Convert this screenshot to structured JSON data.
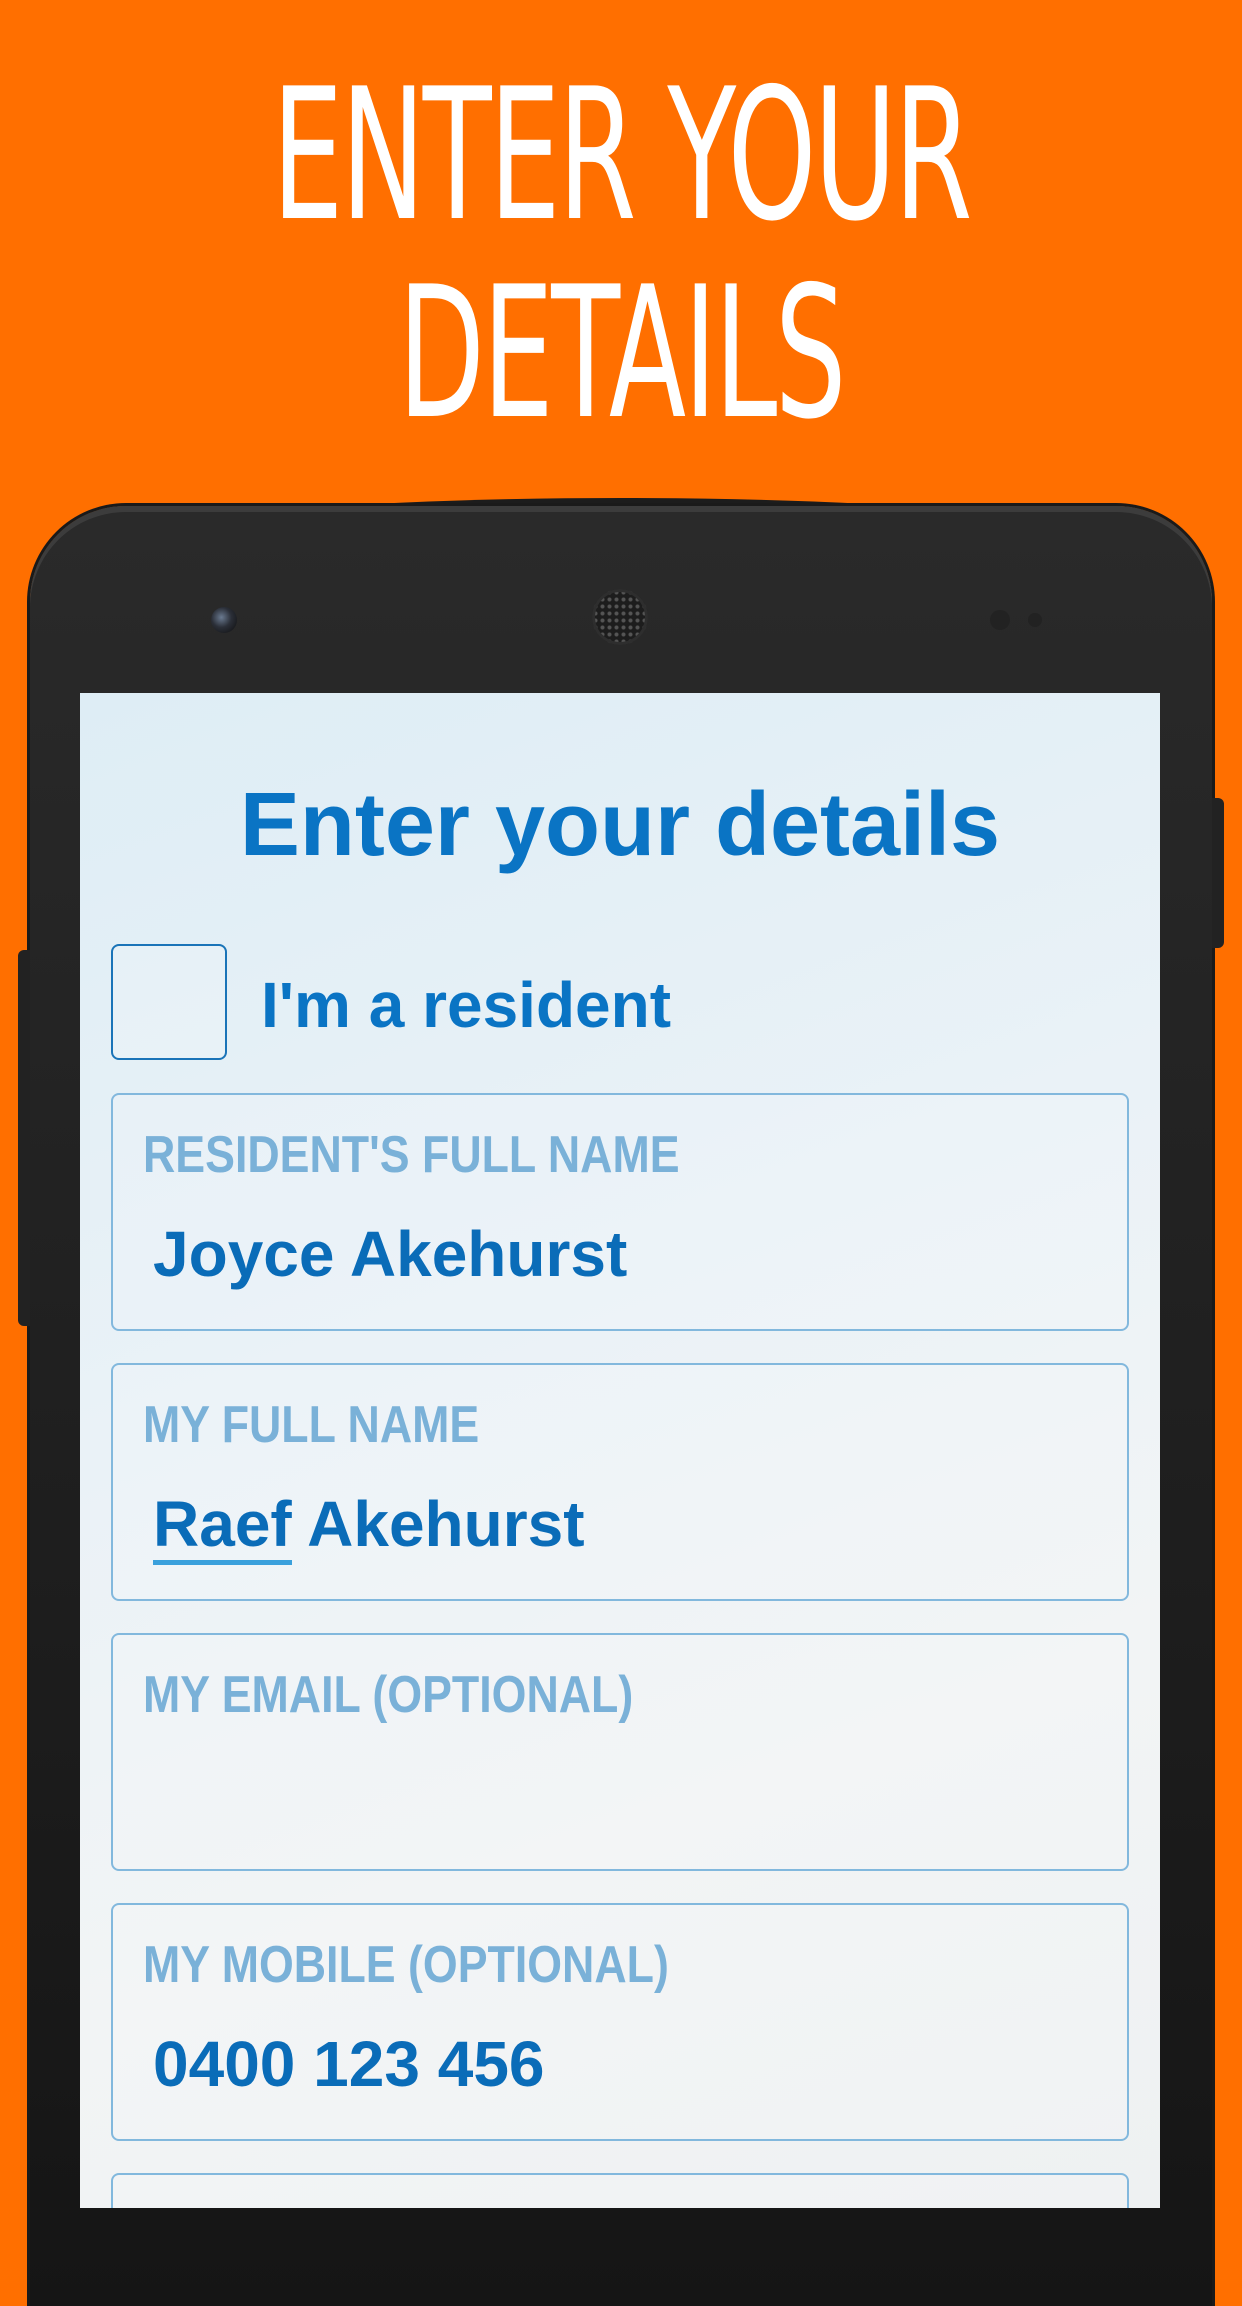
{
  "headline": {
    "line1": "ENTER YOUR",
    "line2": "DETAILS"
  },
  "form": {
    "title": "Enter your details",
    "resident_checkbox_label": "I'm a resident",
    "resident_checkbox_checked": false,
    "fields": [
      {
        "label": "RESIDENT'S FULL NAME",
        "value": "Joyce Akehurst"
      },
      {
        "label": "MY FULL NAME",
        "value_underlined": "Raef",
        "value_rest": " Akehurst"
      },
      {
        "label": "MY EMAIL (OPTIONAL)",
        "value": ""
      },
      {
        "label": "MY MOBILE (OPTIONAL)",
        "value": "0400 123 456"
      }
    ]
  },
  "colors": {
    "background": "#ff6f00",
    "accent_blue": "#0a74c4",
    "label_blue": "#7ab1d8",
    "field_border": "#82b8dd"
  }
}
